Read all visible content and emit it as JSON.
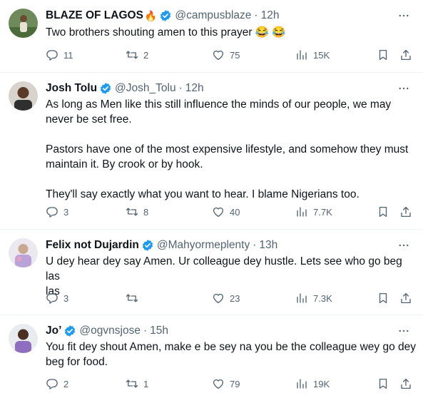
{
  "tweets": [
    {
      "name": "BLAZE OF LAGOS",
      "name_emoji": "🔥",
      "handle": "@campusblaze",
      "time": "12h",
      "text": "Two brothers shouting amen to this prayer 😂 😂",
      "replies": "11",
      "retweets": "2",
      "likes": "75",
      "views": "15K"
    },
    {
      "name": "Josh Tolu",
      "handle": "@Josh_Tolu",
      "time": "12h",
      "text": "As long as Men like this still influence the minds of our people, we may\nnever be set free.\n\nPastors have one of the most expensive lifestyle, and somehow they must\nmaintain it. By crook or by hook.\n\nThey'll say exactly what you want to hear. I blame Nigerians too.",
      "replies": "3",
      "retweets": "8",
      "likes": "40",
      "views": "7.7K"
    },
    {
      "name": "Felix not Dujardin",
      "handle": "@Mahyormeplenty",
      "time": "13h",
      "text": "U dey hear dey say Amen. Ur colleague dey hustle. Lets see who go beg las\nlas",
      "replies": "3",
      "retweets": "",
      "likes": "23",
      "views": "7.3K"
    },
    {
      "name": "Jo’",
      "handle": "@ogvnsjose",
      "time": "15h",
      "text": "You fit dey shout Amen, make e be sey na you be the colleague wey go dey\nbeg for food.",
      "replies": "2",
      "retweets": "1",
      "likes": "79",
      "views": "19K"
    }
  ],
  "separator": "·",
  "colors": {
    "text": "#0f1419",
    "muted": "#536471",
    "verified": "#1d9bf0",
    "divider": "#eff3f4"
  },
  "icons": [
    "reply-icon",
    "retweet-icon",
    "like-icon",
    "views-icon",
    "bookmark-icon",
    "share-icon",
    "more-icon",
    "verified-badge-icon"
  ]
}
